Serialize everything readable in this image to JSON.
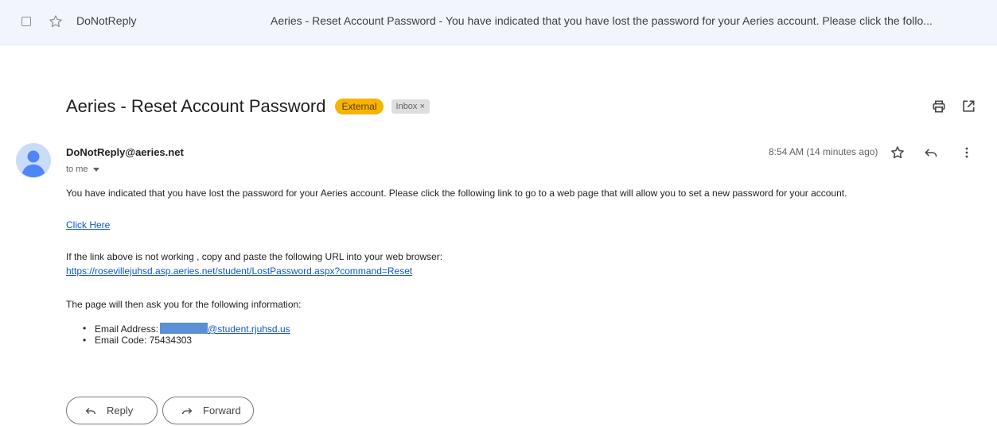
{
  "list_row": {
    "sender": "DoNotReply",
    "snippet": "Aeries - Reset Account Password - You have indicated that you have lost the password for your Aeries account. Please click the follo..."
  },
  "message": {
    "subject": "Aeries - Reset Account Password",
    "labels": {
      "external": "External",
      "inbox": "Inbox",
      "inbox_close": "×"
    },
    "sender_email": "DoNotReply@aeries.net",
    "recipient": "to me",
    "timestamp": "8:54 AM (14 minutes ago)"
  },
  "body": {
    "intro": "You have indicated that you have lost the password for your Aeries account. Please click the following link to go to a web page that will allow you to set a new password for your account.",
    "click_here": "Click Here",
    "fallback_text": "If the link above is not working , copy and paste the following URL into your web browser:",
    "url": "https://rosevillejuhsd.asp.aeries.net/student/LostPassword.aspx?command=Reset",
    "info_intro": "The page will then ask you for the following information:",
    "bullet_marker": "•",
    "email_label": "Email Address:",
    "email_domain": "@student.rjuhsd.us",
    "code_line": "Email Code: 75434303"
  },
  "actions": {
    "reply": "Reply",
    "forward": "Forward"
  },
  "colors": {
    "external_badge": "#f6b400",
    "link": "#1155cc",
    "avatar": "#4f86f7",
    "redaction": "#5b8fd6"
  }
}
